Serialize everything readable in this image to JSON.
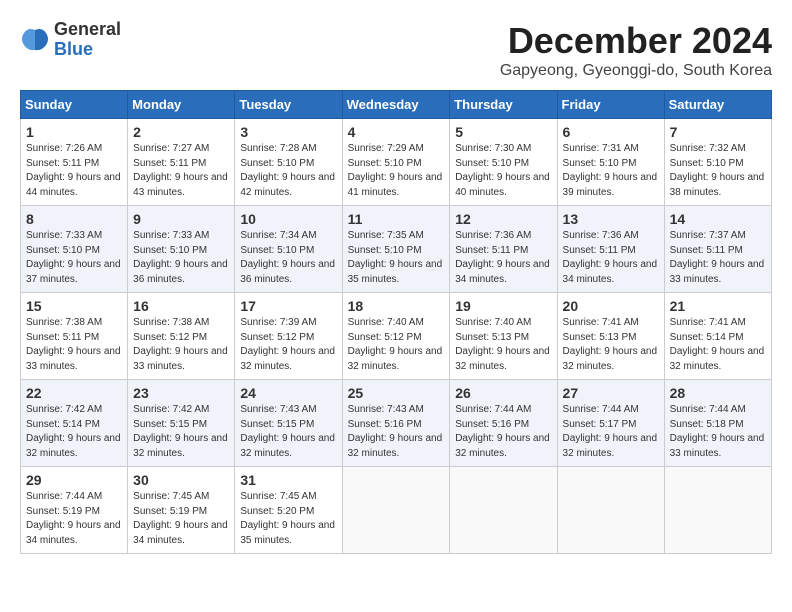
{
  "header": {
    "logo_line1": "General",
    "logo_line2": "Blue",
    "month_title": "December 2024",
    "subtitle": "Gapyeong, Gyeonggi-do, South Korea"
  },
  "weekdays": [
    "Sunday",
    "Monday",
    "Tuesday",
    "Wednesday",
    "Thursday",
    "Friday",
    "Saturday"
  ],
  "weeks": [
    [
      {
        "day": "1",
        "sunrise": "7:26 AM",
        "sunset": "5:11 PM",
        "daylight": "9 hours and 44 minutes."
      },
      {
        "day": "2",
        "sunrise": "7:27 AM",
        "sunset": "5:11 PM",
        "daylight": "9 hours and 43 minutes."
      },
      {
        "day": "3",
        "sunrise": "7:28 AM",
        "sunset": "5:10 PM",
        "daylight": "9 hours and 42 minutes."
      },
      {
        "day": "4",
        "sunrise": "7:29 AM",
        "sunset": "5:10 PM",
        "daylight": "9 hours and 41 minutes."
      },
      {
        "day": "5",
        "sunrise": "7:30 AM",
        "sunset": "5:10 PM",
        "daylight": "9 hours and 40 minutes."
      },
      {
        "day": "6",
        "sunrise": "7:31 AM",
        "sunset": "5:10 PM",
        "daylight": "9 hours and 39 minutes."
      },
      {
        "day": "7",
        "sunrise": "7:32 AM",
        "sunset": "5:10 PM",
        "daylight": "9 hours and 38 minutes."
      }
    ],
    [
      {
        "day": "8",
        "sunrise": "7:33 AM",
        "sunset": "5:10 PM",
        "daylight": "9 hours and 37 minutes."
      },
      {
        "day": "9",
        "sunrise": "7:33 AM",
        "sunset": "5:10 PM",
        "daylight": "9 hours and 36 minutes."
      },
      {
        "day": "10",
        "sunrise": "7:34 AM",
        "sunset": "5:10 PM",
        "daylight": "9 hours and 36 minutes."
      },
      {
        "day": "11",
        "sunrise": "7:35 AM",
        "sunset": "5:10 PM",
        "daylight": "9 hours and 35 minutes."
      },
      {
        "day": "12",
        "sunrise": "7:36 AM",
        "sunset": "5:11 PM",
        "daylight": "9 hours and 34 minutes."
      },
      {
        "day": "13",
        "sunrise": "7:36 AM",
        "sunset": "5:11 PM",
        "daylight": "9 hours and 34 minutes."
      },
      {
        "day": "14",
        "sunrise": "7:37 AM",
        "sunset": "5:11 PM",
        "daylight": "9 hours and 33 minutes."
      }
    ],
    [
      {
        "day": "15",
        "sunrise": "7:38 AM",
        "sunset": "5:11 PM",
        "daylight": "9 hours and 33 minutes."
      },
      {
        "day": "16",
        "sunrise": "7:38 AM",
        "sunset": "5:12 PM",
        "daylight": "9 hours and 33 minutes."
      },
      {
        "day": "17",
        "sunrise": "7:39 AM",
        "sunset": "5:12 PM",
        "daylight": "9 hours and 32 minutes."
      },
      {
        "day": "18",
        "sunrise": "7:40 AM",
        "sunset": "5:12 PM",
        "daylight": "9 hours and 32 minutes."
      },
      {
        "day": "19",
        "sunrise": "7:40 AM",
        "sunset": "5:13 PM",
        "daylight": "9 hours and 32 minutes."
      },
      {
        "day": "20",
        "sunrise": "7:41 AM",
        "sunset": "5:13 PM",
        "daylight": "9 hours and 32 minutes."
      },
      {
        "day": "21",
        "sunrise": "7:41 AM",
        "sunset": "5:14 PM",
        "daylight": "9 hours and 32 minutes."
      }
    ],
    [
      {
        "day": "22",
        "sunrise": "7:42 AM",
        "sunset": "5:14 PM",
        "daylight": "9 hours and 32 minutes."
      },
      {
        "day": "23",
        "sunrise": "7:42 AM",
        "sunset": "5:15 PM",
        "daylight": "9 hours and 32 minutes."
      },
      {
        "day": "24",
        "sunrise": "7:43 AM",
        "sunset": "5:15 PM",
        "daylight": "9 hours and 32 minutes."
      },
      {
        "day": "25",
        "sunrise": "7:43 AM",
        "sunset": "5:16 PM",
        "daylight": "9 hours and 32 minutes."
      },
      {
        "day": "26",
        "sunrise": "7:44 AM",
        "sunset": "5:16 PM",
        "daylight": "9 hours and 32 minutes."
      },
      {
        "day": "27",
        "sunrise": "7:44 AM",
        "sunset": "5:17 PM",
        "daylight": "9 hours and 32 minutes."
      },
      {
        "day": "28",
        "sunrise": "7:44 AM",
        "sunset": "5:18 PM",
        "daylight": "9 hours and 33 minutes."
      }
    ],
    [
      {
        "day": "29",
        "sunrise": "7:44 AM",
        "sunset": "5:19 PM",
        "daylight": "9 hours and 34 minutes."
      },
      {
        "day": "30",
        "sunrise": "7:45 AM",
        "sunset": "5:19 PM",
        "daylight": "9 hours and 34 minutes."
      },
      {
        "day": "31",
        "sunrise": "7:45 AM",
        "sunset": "5:20 PM",
        "daylight": "9 hours and 35 minutes."
      },
      null,
      null,
      null,
      null
    ]
  ]
}
